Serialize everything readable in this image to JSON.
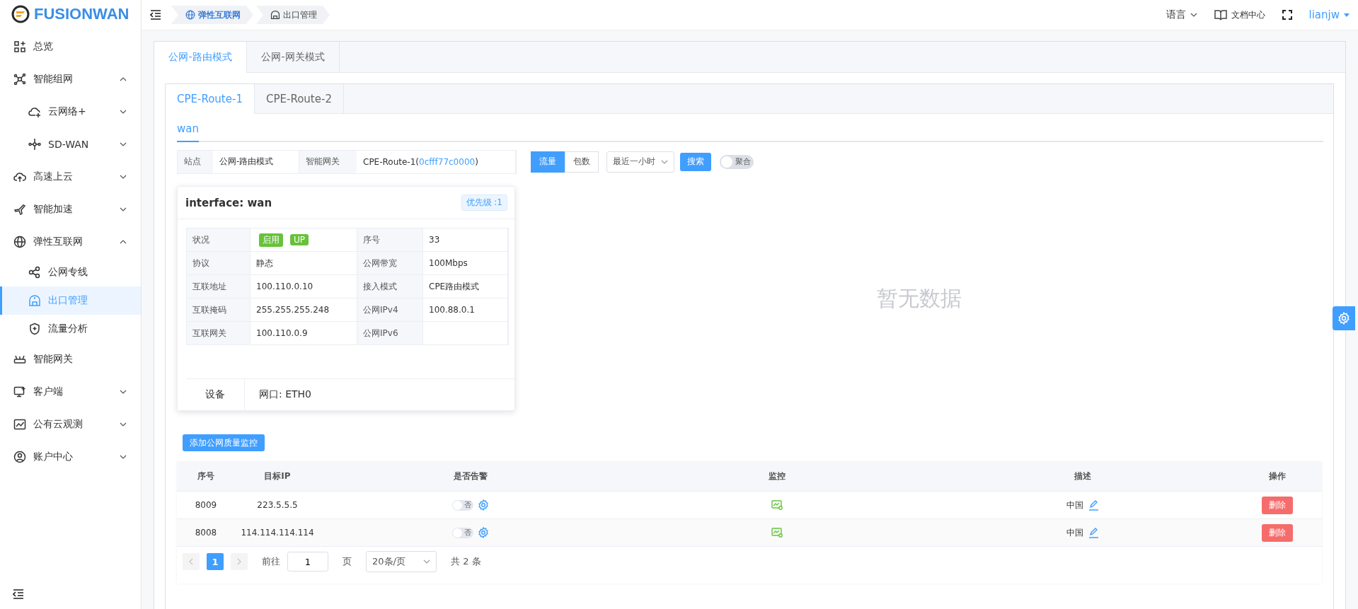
{
  "sidebar": {
    "logo": "FUSIONWAN",
    "items": [
      {
        "label": "总览",
        "selected": false
      },
      {
        "label": "智能组网",
        "selected": false,
        "expanded": true,
        "children": [
          {
            "label": "云网络+",
            "selected": false,
            "expanded": false
          },
          {
            "label": "SD-WAN",
            "selected": false,
            "expanded": false
          }
        ]
      },
      {
        "label": "高速上云",
        "selected": false,
        "expanded": false
      },
      {
        "label": "智能加速",
        "selected": false,
        "expanded": false
      },
      {
        "label": "弹性互联网",
        "selected": false,
        "expanded": true,
        "children": [
          {
            "label": "公网专线",
            "selected": false
          },
          {
            "label": "出口管理",
            "selected": true
          },
          {
            "label": "流量分析",
            "selected": false
          }
        ]
      },
      {
        "label": "智能网关",
        "selected": false
      },
      {
        "label": "客户端",
        "selected": false,
        "expanded": false
      },
      {
        "label": "公有云观测",
        "selected": false,
        "expanded": false
      },
      {
        "label": "账户中心",
        "selected": false,
        "expanded": false
      }
    ]
  },
  "topbar": {
    "breadcrumbs": [
      {
        "label": "弹性互联网",
        "selected": true
      },
      {
        "label": "出口管理",
        "selected": false
      }
    ],
    "language": "语言",
    "docs": "文档中心",
    "user": "lianjw"
  },
  "mode_tabs": [
    {
      "label": "公网-路由模式",
      "selected": true
    },
    {
      "label": "公网-网关模式",
      "selected": false
    }
  ],
  "device_tabs": [
    {
      "label": "CPE-Route-1",
      "selected": true
    },
    {
      "label": "CPE-Route-2",
      "selected": false
    }
  ],
  "interface_tabs": [
    {
      "label": "wan",
      "selected": true
    }
  ],
  "filter": {
    "site_label": "站点",
    "site": "公网-路由模式",
    "gateway_label": "智能网关",
    "gateway_parts": [
      {
        "text": "CPE-Route-1(",
        "link": false
      },
      {
        "text": "0cfff77c0000",
        "link": true
      },
      {
        "text": ")",
        "link": false
      }
    ],
    "metrics": [
      {
        "label": "流量",
        "selected": true
      },
      {
        "label": "包数",
        "selected": false
      }
    ],
    "range": "最近一小时",
    "search": "搜索",
    "aggregate": {
      "label": "聚合",
      "on": false
    }
  },
  "interface": {
    "title": "interface: wan",
    "priority": "优先级 :1",
    "fields": [
      {
        "label": "状况",
        "kind": "tags",
        "tags": [
          "启用",
          "UP"
        ]
      },
      {
        "label": "序号",
        "kind": "text",
        "value": "33"
      },
      {
        "label": "协议",
        "kind": "text",
        "value": "静态"
      },
      {
        "label": "公网带宽",
        "kind": "text",
        "value": "100Mbps"
      },
      {
        "label": "互联地址",
        "kind": "text",
        "value": "100.110.0.10"
      },
      {
        "label": "接入模式",
        "kind": "text",
        "value": "CPE路由模式"
      },
      {
        "label": "互联掩码",
        "kind": "text",
        "value": "255.255.255.248"
      },
      {
        "label": "公网IPv4",
        "kind": "text",
        "value": "100.88.0.1"
      },
      {
        "label": "互联网关",
        "kind": "text",
        "value": "100.110.0.9"
      },
      {
        "label": "公网IPv6",
        "kind": "text"
      }
    ],
    "device_label": "设备",
    "device": "网口: ETH0"
  },
  "chart_empty": "暂无数据",
  "add_button": "添加公网质量监控",
  "table": {
    "columns": [
      "序号",
      "目标IP",
      "是否告警",
      "监控",
      "描述",
      "操作"
    ],
    "rows": [
      {
        "id": "8009",
        "ip": "223.5.5.5",
        "alert": {
          "on": false,
          "text": "否"
        },
        "description": "中国",
        "action": "删除"
      },
      {
        "id": "8008",
        "ip": "114.114.114.114",
        "alert": {
          "on": false,
          "text": "否"
        },
        "description": "中国",
        "action": "删除"
      }
    ]
  },
  "pagination": {
    "pages": [
      {
        "label": "1",
        "selected": true
      }
    ],
    "goto": "前往",
    "page_input": "1",
    "page_unit": "页",
    "page_size": "20条/页",
    "total": "共 2 条"
  }
}
